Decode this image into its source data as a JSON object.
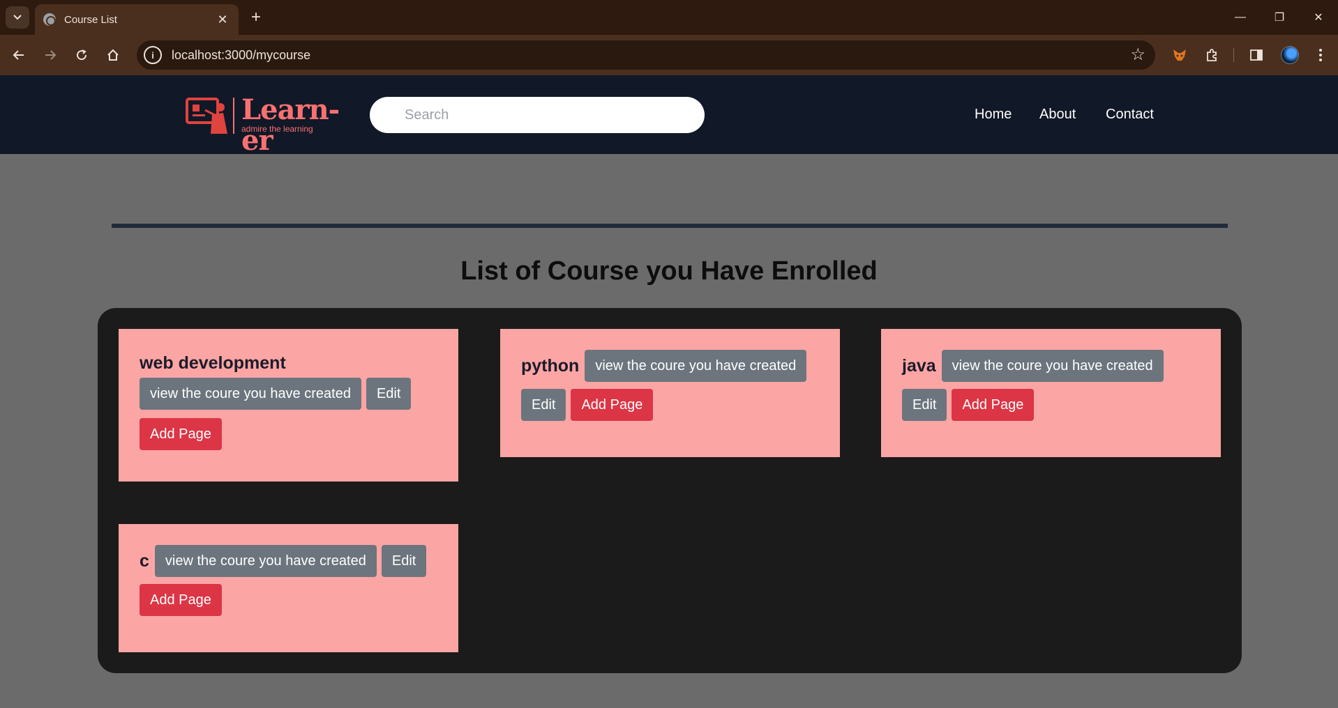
{
  "browser": {
    "tab_title": "Course List",
    "new_tab_symbol": "+",
    "url": "localhost:3000/mycourse",
    "controls": {
      "minimize": "—",
      "restore": "❐",
      "close": "✕"
    }
  },
  "nav": {
    "logo_text": "Learn-er",
    "logo_tagline": "admire the learning",
    "search_placeholder": "Search",
    "links": [
      "Home",
      "About",
      "Contact"
    ]
  },
  "page": {
    "title": "List of Course you Have Enrolled"
  },
  "courses": [
    {
      "name": "web development",
      "view_label": "view the coure you have created",
      "edit_label": "Edit",
      "add_label": "Add Page"
    },
    {
      "name": "python",
      "view_label": "view the coure you have created",
      "edit_label": "Edit",
      "add_label": "Add Page"
    },
    {
      "name": "java",
      "view_label": "view the coure you have created",
      "edit_label": "Edit",
      "add_label": "Add Page"
    },
    {
      "name": "c",
      "view_label": "view the coure you have created",
      "edit_label": "Edit",
      "add_label": "Add Page"
    }
  ],
  "colors": {
    "navbar": "#111827",
    "card": "#fca5a5",
    "secondary_button": "#6c757d",
    "danger_button": "#dc3545",
    "panel": "#1b1b1b",
    "logo": "#f87171"
  },
  "icons": [
    "tab-search-icon",
    "globe-icon",
    "close-icon",
    "plus-icon",
    "back-icon",
    "forward-icon",
    "reload-icon",
    "home-icon",
    "site-info-icon",
    "star-icon",
    "metamask-icon",
    "extensions-icon",
    "side-panel-icon",
    "menu-icon"
  ]
}
